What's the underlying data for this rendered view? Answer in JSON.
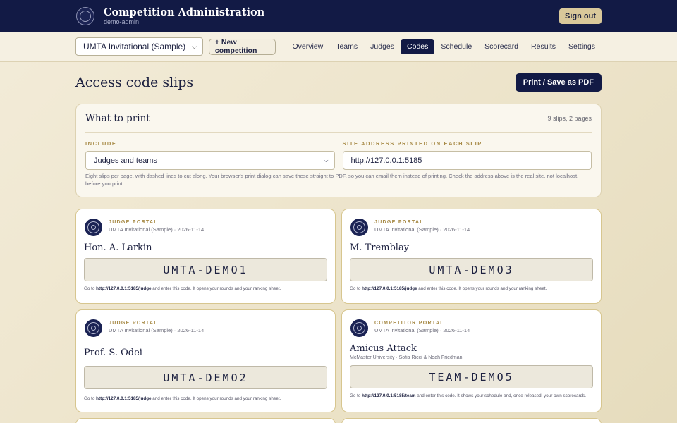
{
  "header": {
    "title": "Competition Administration",
    "user": "demo-admin",
    "signout_label": "Sign out"
  },
  "nav": {
    "competition_selected": "UMTA Invitational (Sample)",
    "new_competition_label": "+ New competition",
    "tabs": [
      "Overview",
      "Teams",
      "Judges",
      "Codes",
      "Schedule",
      "Scorecard",
      "Results",
      "Settings"
    ],
    "active_tab": "Codes"
  },
  "page": {
    "title": "Access code slips",
    "print_label": "Print / Save as PDF"
  },
  "panel": {
    "title": "What to print",
    "count": "9 slips, 2 pages",
    "include_label": "INCLUDE",
    "include_value": "Judges and teams",
    "address_label": "SITE ADDRESS PRINTED ON EACH SLIP",
    "address_value": "http://127.0.0.1:5185",
    "help": "Eight slips per page, with dashed lines to cut along. Your browser's print dialog can save these straight to PDF, so you can email them instead of printing. Check the address above is the real site, not localhost, before you print."
  },
  "slips": [
    {
      "portal": "JUDGE PORTAL",
      "comp": "UMTA Invitational (Sample) · 2026-11-14",
      "name": "Hon. A. Larkin",
      "code": "UMTA-DEMO1",
      "instr_pre": "Go to ",
      "instr_url": "http://127.0.0.1:5185/judge",
      "instr_post": " and enter this code. It opens your rounds and your ranking sheet."
    },
    {
      "portal": "JUDGE PORTAL",
      "comp": "UMTA Invitational (Sample) · 2026-11-14",
      "name": "M. Tremblay",
      "code": "UMTA-DEMO3",
      "instr_pre": "Go to ",
      "instr_url": "http://127.0.0.1:5185/judge",
      "instr_post": " and enter this code. It opens your rounds and your ranking sheet."
    },
    {
      "portal": "JUDGE PORTAL",
      "comp": "UMTA Invitational (Sample) · 2026-11-14",
      "name": "Prof. S. Odei",
      "code": "UMTA-DEMO2",
      "instr_pre": "Go to ",
      "instr_url": "http://127.0.0.1:5185/judge",
      "instr_post": " and enter this code. It opens your rounds and your ranking sheet."
    },
    {
      "portal": "COMPETITOR PORTAL",
      "comp": "UMTA Invitational (Sample) · 2026-11-14",
      "name": "Amicus Attack",
      "sub": "McMaster University · Sofia Ricci & Noah Friedman",
      "code": "TEAM-DEMO5",
      "instr_pre": "Go to ",
      "instr_url": "http://127.0.0.1:5185/team",
      "instr_post": " and enter this code. It shows your schedule and, once released, your own scorecards."
    }
  ]
}
